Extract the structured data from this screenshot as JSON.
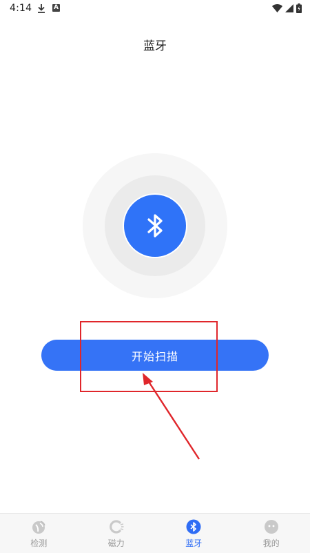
{
  "status_bar": {
    "time": "4:14",
    "a_badge": "A"
  },
  "page": {
    "title": "蓝牙"
  },
  "scan": {
    "label": "开始扫描"
  },
  "nav": {
    "items": [
      {
        "label": "检测",
        "icon": "detect-icon",
        "active": false
      },
      {
        "label": "磁力",
        "icon": "magnet-icon",
        "active": false
      },
      {
        "label": "蓝牙",
        "icon": "bluetooth-icon",
        "active": true
      },
      {
        "label": "我的",
        "icon": "profile-icon",
        "active": false
      }
    ]
  },
  "colors": {
    "accent": "#2f73f8",
    "annotation": "#e0262b",
    "inactive": "#9a9a9a"
  }
}
